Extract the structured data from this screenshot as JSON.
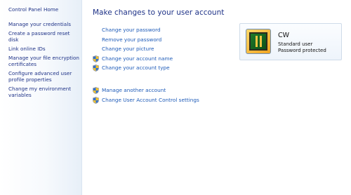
{
  "sidebar": {
    "home": "Control Panel Home",
    "links": [
      {
        "label": "Manage your credentials"
      },
      {
        "label": "Create a password reset disk"
      },
      {
        "label": "Link online IDs"
      },
      {
        "label": "Manage your file encryption certificates"
      },
      {
        "label": "Configure advanced user profile properties"
      },
      {
        "label": "Change my environment variables"
      }
    ]
  },
  "main": {
    "title": "Make changes to your user account",
    "tasks": [
      {
        "label": "Change your password",
        "icon": "none"
      },
      {
        "label": "Remove your password",
        "icon": "none"
      },
      {
        "label": "Change your picture",
        "icon": "none"
      },
      {
        "label": "Change your account name",
        "icon": "shield-icon"
      },
      {
        "label": "Change your account type",
        "icon": "shield-icon"
      }
    ],
    "secondary_tasks": [
      {
        "label": "Manage another account",
        "icon": "shield-icon"
      },
      {
        "label": "Change User Account Control settings",
        "icon": "shield-icon"
      }
    ]
  },
  "account": {
    "name": "CW",
    "type": "Standard user",
    "status": "Password protected"
  },
  "colors": {
    "link": "#1e5bb8",
    "heading": "#1e3287",
    "sidebar_edge": "#e7eff8"
  }
}
